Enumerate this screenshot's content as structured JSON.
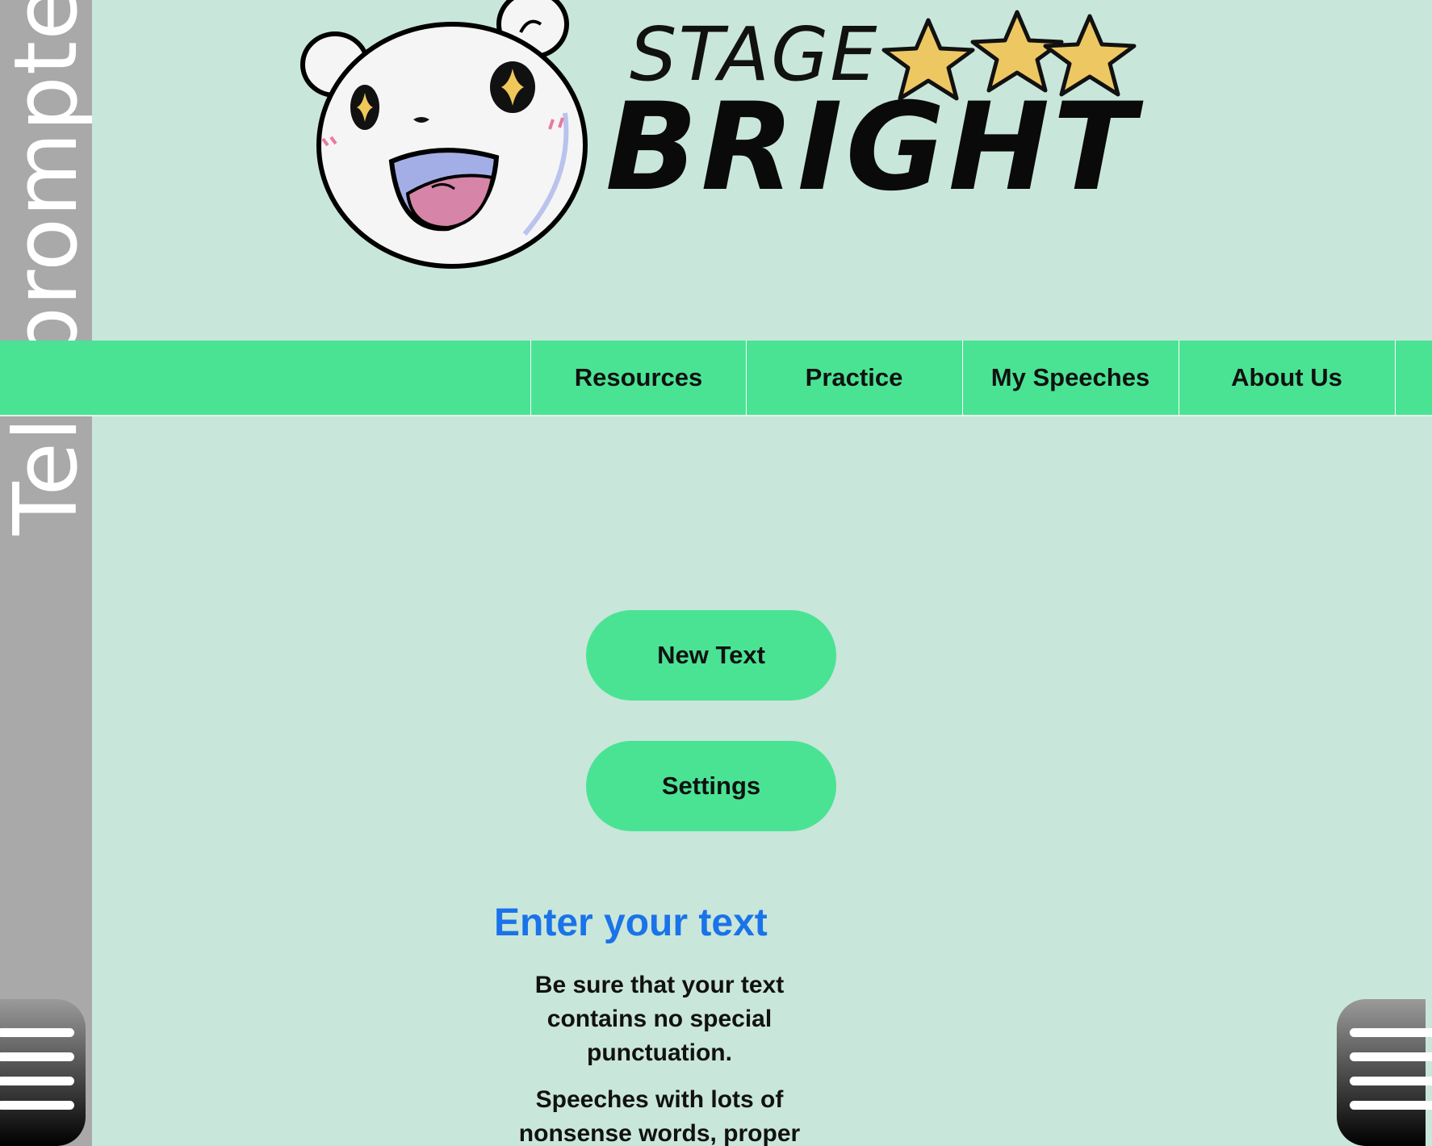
{
  "side_tab": {
    "label": "Teleprompter"
  },
  "logo": {
    "line1": "STAGE",
    "line2": "BRIGHT"
  },
  "nav": {
    "items": [
      {
        "label": "Resources"
      },
      {
        "label": "Practice"
      },
      {
        "label": "My Speeches"
      },
      {
        "label": "About Us"
      }
    ]
  },
  "buttons": {
    "new_text": "New Text",
    "settings": "Settings"
  },
  "content": {
    "heading": "Enter your text",
    "paragraph1": "Be sure that your text contains no special punctuation.",
    "paragraph2": "Speeches with lots of nonsense words, proper"
  },
  "colors": {
    "background": "#c9e6da",
    "accent_green": "#4ae394",
    "heading_blue": "#1a73e8",
    "side_strip": "#a9a9a9"
  },
  "icons": {
    "left_menu": "hamburger-menu-icon",
    "right_menu": "hamburger-menu-icon",
    "mascot": "bear-mascot-icon",
    "stars": "star-icon"
  }
}
